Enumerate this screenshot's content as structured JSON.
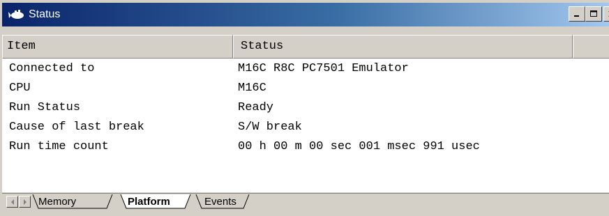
{
  "window": {
    "title": "Status",
    "icon": "status-window-icon",
    "controls": {
      "minimize": "minimize-icon",
      "maximize": "maximize-icon",
      "close": "close-icon"
    }
  },
  "table": {
    "headers": [
      "Item",
      "Status"
    ],
    "rows": [
      {
        "item": "Connected to",
        "status": "M16C R8C PC7501 Emulator"
      },
      {
        "item": "CPU",
        "status": "M16C"
      },
      {
        "item": "Run Status",
        "status": "Ready"
      },
      {
        "item": "Cause of last break",
        "status": "S/W break"
      },
      {
        "item": "Run time count",
        "status": "00 h 00 m 00 sec 001 msec 991 usec"
      }
    ]
  },
  "tabs": [
    {
      "label": "Memory",
      "active": false
    },
    {
      "label": "Platform",
      "active": true
    },
    {
      "label": "Events",
      "active": false
    }
  ],
  "colors": {
    "titlebar_start": "#0a246a",
    "titlebar_end": "#a6caf0",
    "face": "#d4d0c8"
  }
}
